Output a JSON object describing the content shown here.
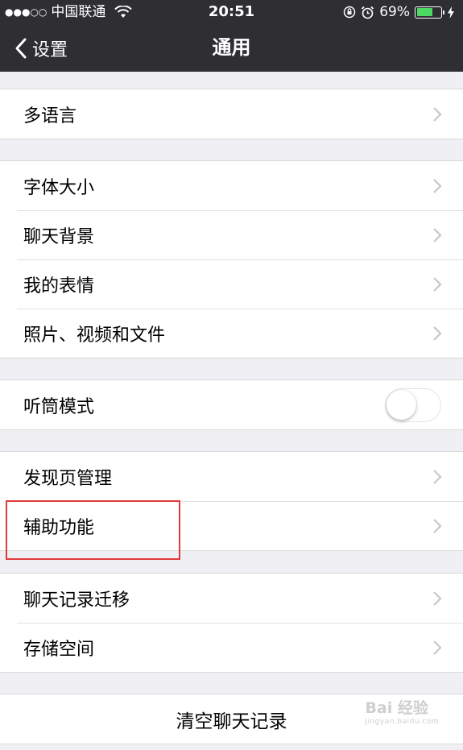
{
  "status_bar": {
    "signal": "●●●○○",
    "carrier": "中国联通",
    "time": "20:51",
    "battery_percent": "69%",
    "battery_level": 0.69,
    "battery_color": "#4cd964"
  },
  "nav": {
    "back_label": "设置",
    "title": "通用"
  },
  "groups": [
    {
      "items": [
        {
          "label": "多语言"
        }
      ]
    },
    {
      "items": [
        {
          "label": "字体大小"
        },
        {
          "label": "聊天背景"
        },
        {
          "label": "我的表情"
        },
        {
          "label": "照片、视频和文件"
        }
      ]
    },
    {
      "items": [
        {
          "label": "听筒模式",
          "toggle": false
        }
      ]
    },
    {
      "items": [
        {
          "label": "发现页管理"
        },
        {
          "label": "辅助功能",
          "highlighted": true
        }
      ]
    },
    {
      "items": [
        {
          "label": "聊天记录迁移"
        },
        {
          "label": "存储空间"
        }
      ]
    }
  ],
  "clear_history_label": "清空聊天记录",
  "watermark": {
    "brand": "Bai 经验",
    "url": "jingyan.baidu.com"
  },
  "colors": {
    "nav_background": "#2e2e33",
    "page_background": "#efeff4",
    "highlight_border": "#e23b3b"
  }
}
